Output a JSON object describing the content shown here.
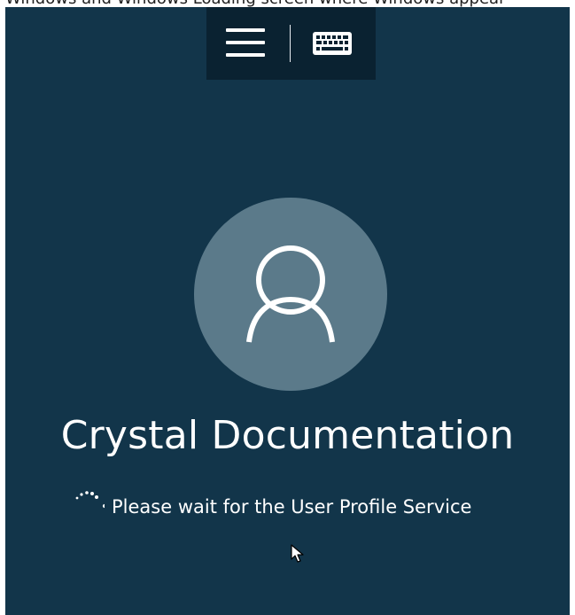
{
  "caption": {
    "text": "Windows and Windows Loading screen where Windows appear"
  },
  "toolbar": {
    "menu_icon": "hamburger-icon",
    "keyboard_icon": "keyboard-icon"
  },
  "user": {
    "avatar_icon": "user-silhouette-icon",
    "name": "Crystal Documentation"
  },
  "status": {
    "spinner_icon": "loading-dots-icon",
    "message": "Please wait for the User Profile Service"
  },
  "colors": {
    "background": "#12354a",
    "toolbar": "#0a2231",
    "avatar_circle": "#5b7a8a",
    "text": "#ffffff"
  }
}
